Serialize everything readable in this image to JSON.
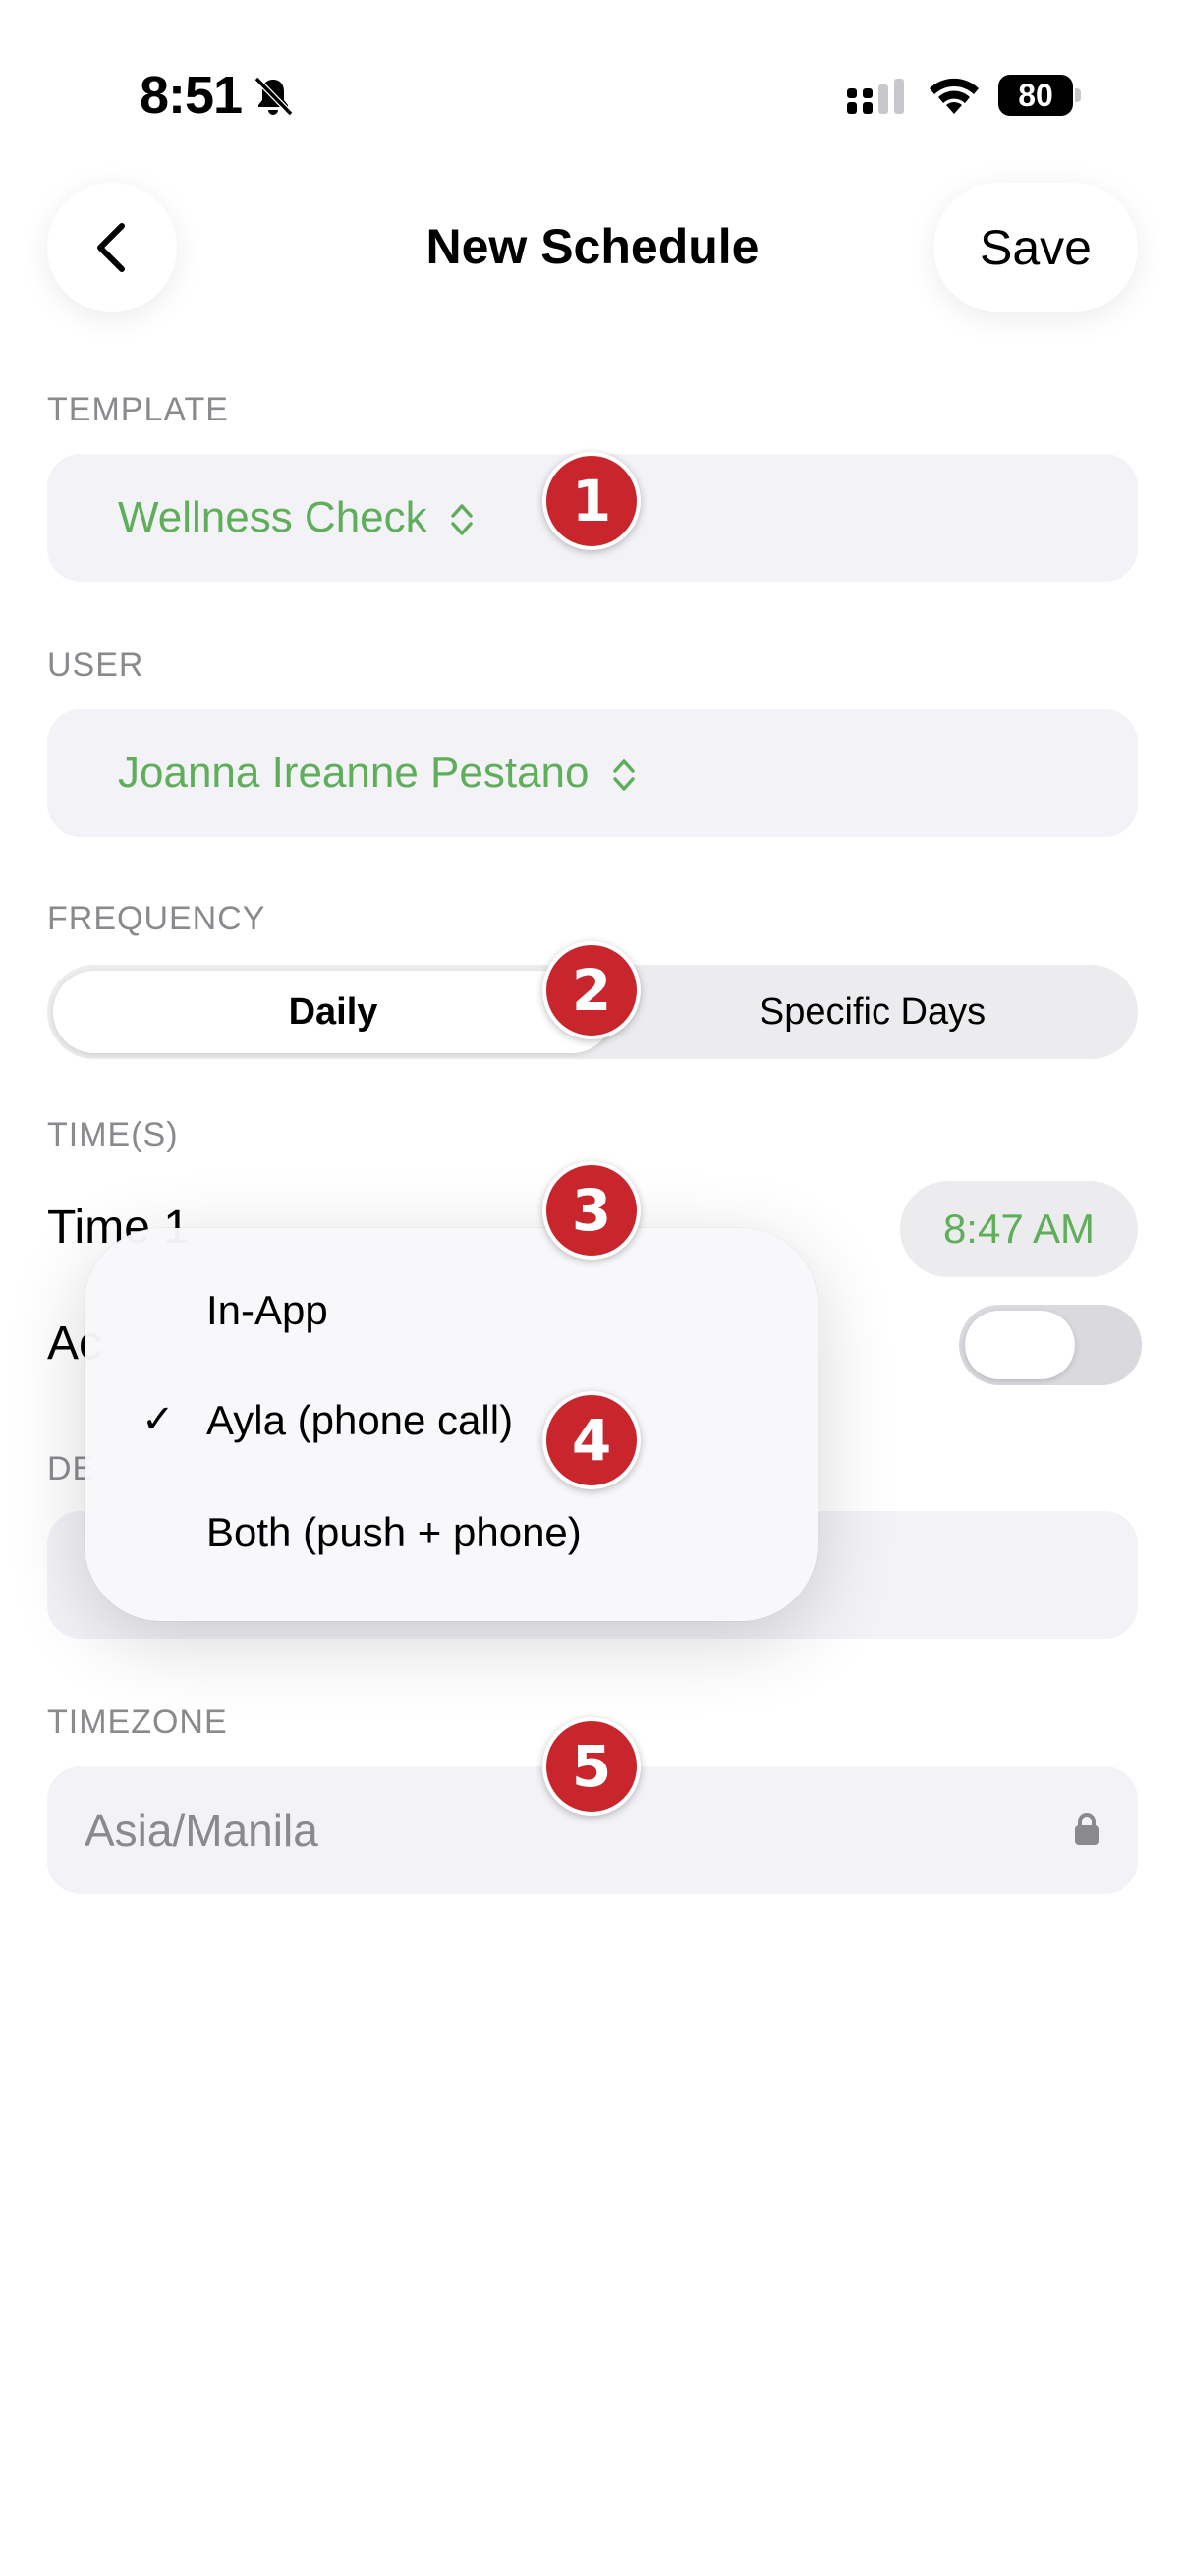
{
  "status_bar": {
    "time": "8:51",
    "battery": "80",
    "icons": [
      "bell-slash-icon",
      "signal-icon",
      "wifi-icon",
      "battery-icon"
    ]
  },
  "nav": {
    "back_icon": "chevron-left-icon",
    "title": "New Schedule",
    "save_label": "Save"
  },
  "template": {
    "label": "TEMPLATE",
    "value": "Wellness Check"
  },
  "user": {
    "label": "USER",
    "value": "Joanna Ireanne Pestano"
  },
  "frequency": {
    "label": "FREQUENCY",
    "options": [
      "Daily",
      "Specific Days"
    ],
    "selected": "Daily"
  },
  "times": {
    "label": "TIME(S)",
    "time1_label": "Time 1",
    "time1_value": "8:47 AM",
    "partial_row_label": "Ac",
    "partial_section_label": "DE"
  },
  "timezone": {
    "label": "TIMEZONE",
    "value": "Asia/Manila"
  },
  "menu": {
    "items": [
      "In-App",
      "Ayla (phone call)",
      "Both (push + phone)"
    ],
    "checked_index": 1,
    "check_glyph": "✓"
  },
  "badges": [
    "1",
    "2",
    "3",
    "4",
    "5"
  ],
  "colors": {
    "accent_green": "#5fae5a",
    "badge_red": "#c8252c",
    "field_bg": "#f2f2f7"
  }
}
